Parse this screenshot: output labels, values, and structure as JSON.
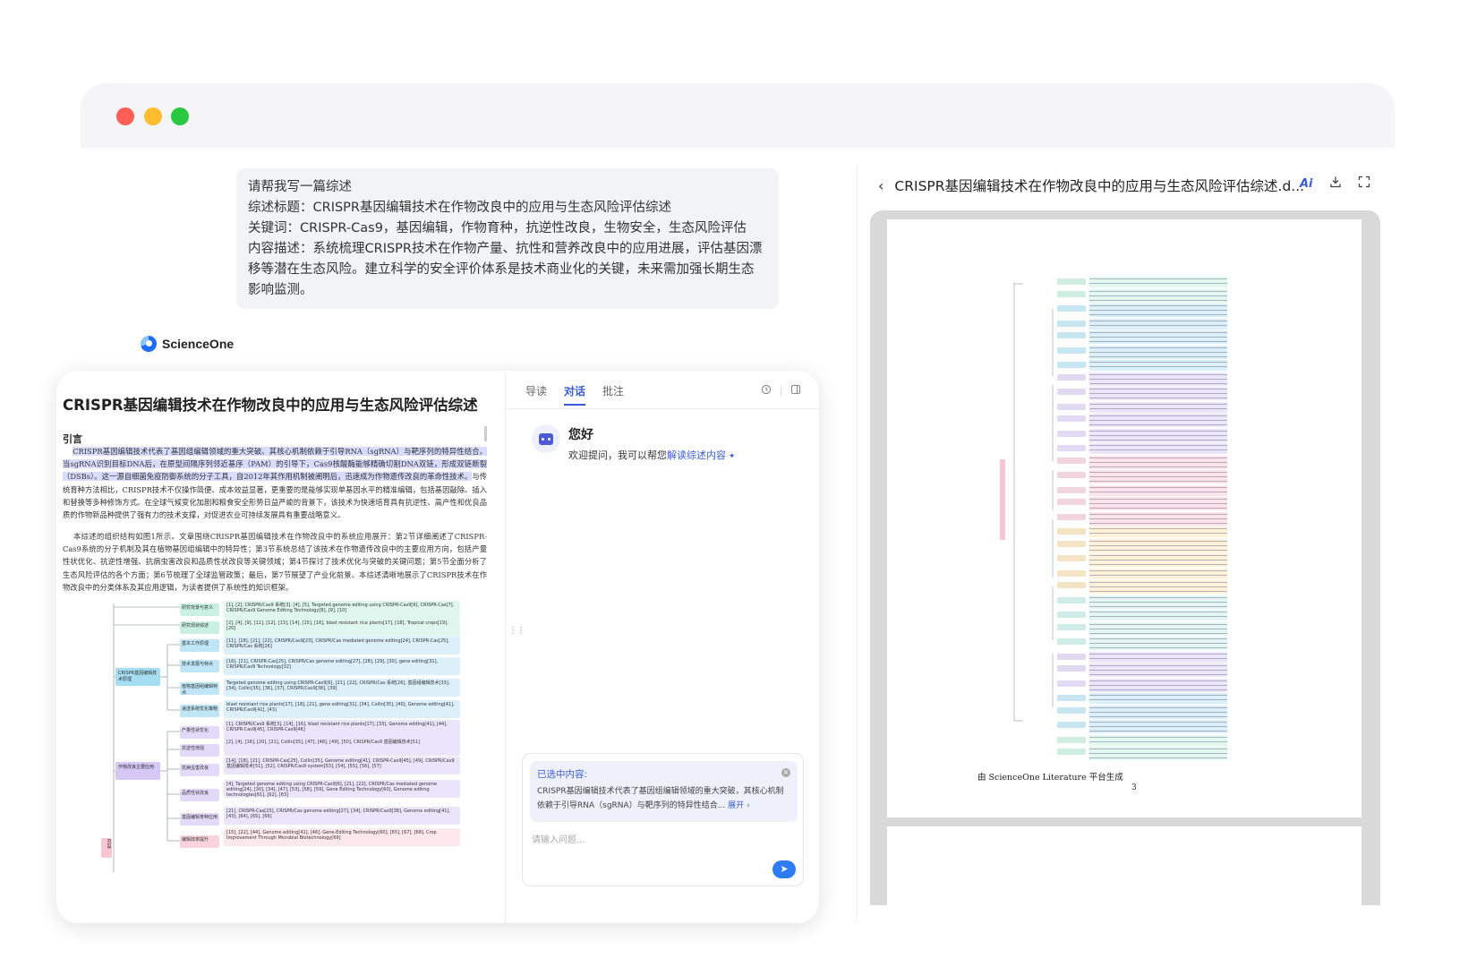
{
  "window": {
    "dots": [
      "#ff5f57",
      "#febc2e",
      "#28c840"
    ]
  },
  "prompt": {
    "lines": [
      "请帮我写一篇综述",
      "综述标题：CRISPR基因编辑技术在作物改良中的应用与生态风险评估综述",
      "关键词：CRISPR-Cas9，基因编辑，作物育种，抗逆性改良，生物安全，生态风险评估",
      "内容描述：系统梳理CRISPR技术在作物产量、抗性和营养改良中的应用进展，评估基因漂移等潜在生态风险。建立科学的安全评价体系是技术商业化的关键，未来需加强长期生态影响监测。"
    ]
  },
  "brand": {
    "name": "ScienceOne"
  },
  "doc": {
    "title": "CRISPR基因编辑技术在作物改良中的应用与生态风险评估综述",
    "section": "引言",
    "para1_hl": "CRISPR基因编辑技术代表了基因组编辑领域的重大突破。其核心机制依赖于引导RNA（sgRNA）与靶序列的特异性结合。当sgRNA识别目标DNA后，在原型间隔序列邻近基序（PAM）的引导下，Cas9核酸酶能够精确切割DNA双链，形成双链断裂（DSBs）。这一源自细菌免疫防御系统的分子工具，自2012年其作用机制被阐明后，迅速成为作物遗传改良的革命性技术。",
    "para1_rest": "与传统育种方法相比，CRISPR技术不仅操作简便、成本效益显著，更重要的是能够实现单基因水平的精准编辑，包括基因敲除、插入和替换等多种修饰方式。在全球气候变化加剧和粮食安全形势日益严峻的背景下，该技术为快速培育具有抗逆性、高产性和优良品质的作物新品种提供了强有力的技术支撑，对促进农业可持续发展具有重要战略意义。",
    "para2": "本综述的组织结构如图1所示。文章围绕CRISPR基因编辑技术在作物改良中的系统应用展开：第2节详细阐述了CRISPR-Cas9系统的分子机制及其在植物基因组编辑中的特异性；第3节系统总结了该技术在作物遗传改良中的主要应用方向，包括产量性状优化、抗逆性增强、抗病虫害改良和品质性状改良等关键领域；第4节探讨了技术优化与突破的关键问题；第5节全面分析了生态风险评估的各个方面；第6节梳理了全球监管政策；最后，第7节展望了产业化前景。本综述清晰地展示了CRISPR技术在作物改良中的分类体系及其应用逻辑，为读者提供了系统性的知识框架。",
    "mindmap": {
      "l1": [
        {
          "label": "CRISPR基因编辑技术原理",
          "color": "#a5ddf2"
        },
        {
          "label": "作物改良主要应用",
          "color": "#d5c8f7"
        },
        {
          "label": "RGB",
          "color": "#f7c6d2"
        }
      ],
      "l2": [
        {
          "label": "研究背景与意义",
          "color": "#c9f0e3"
        },
        {
          "label": "研究现状综述",
          "color": "#c9f0e3"
        },
        {
          "label": "基本工作原理",
          "color": "#bfe6f7"
        },
        {
          "label": "技术发展与特点",
          "color": "#bfe6f7"
        },
        {
          "label": "植物基因组编辑特点",
          "color": "#bfe6f7"
        },
        {
          "label": "递送系统优化策略",
          "color": "#bfe6f7"
        },
        {
          "label": "产量性状优化",
          "color": "#e2daf9"
        },
        {
          "label": "抗逆性增强",
          "color": "#e2daf9"
        },
        {
          "label": "抗病虫害改良",
          "color": "#e2daf9"
        },
        {
          "label": "品质性状改良",
          "color": "#e2daf9"
        },
        {
          "label": "基因编辑育种应用",
          "color": "#e2daf9"
        },
        {
          "label": "编辑效率提升",
          "color": "#fad4dd"
        }
      ],
      "rows": [
        {
          "text": "[1], [2], CRISPR/Cas9 系统[3], [4], [5], Targeted genome editing using CRISPR-Cas9[6], CRISPR-Cas[7], CRISPR/Cas9 Genome Editing Technology[8], [9], [10]",
          "color": "#dff7ee"
        },
        {
          "text": "[2], [4], [9], [11], [12], [13], [14], [15], [16], blast resistant rice plants[17], [18], Tropical crops[19], [20]",
          "color": "#dff7ee"
        },
        {
          "text": "[11], [18], [21], [22], CRISPR/Cas9[23], CRISPR/Cas mediated genome editing[24], CRISPR-Cas[25], CRISPR/Cas 系统[26]",
          "color": "#dcf0fa"
        },
        {
          "text": "[16], [21], CRISPR-Cas[25], CRISPR/Cas genome editing[27], [28], [29], [30], gene editing[31], CRISPR/Cas9 Technology[32]",
          "color": "#dcf0fa"
        },
        {
          "text": "Targeted genome editing using CRISPR-Cas9[6], [21], [22], CRISPR/Cas 系统[26], 基因组编辑技术[33], [34], Collin[35], [36], [37], CRISPR/Cas9[38], [39]",
          "color": "#dcf0fa"
        },
        {
          "text": "blast resistant rice plants[17], [18], [21], gene editing[31], [34], Collin[35], [40], Genome editing[41], CRISPR/Cas9[42], [43]",
          "color": "#dcf0fa"
        },
        {
          "text": "[1], CRISPR/Cas9 系统[3], [14], [16], blast resistant rice plants[17], [33], Genome editing[41], [44], CRISPR-Cas9[45], CRISPR-Cas9[46]",
          "color": "#ebe5fb"
        },
        {
          "text": "[2], [4], [16], [20], [21], Collin[35], [47], [48], [49], [50], CRISPR/Cas9 基因编辑技术[51]",
          "color": "#ebe5fb"
        },
        {
          "text": "[14], [18], [21], CRISPR-Cas[25], Collin[35], Genome editing[41], CRISPR-Cas9[45], [49], CRISPR/Cas9 基因编辑技术[51], [52], CRISPR/Cas9 system[53], [54], [55], [56], [57]",
          "color": "#ebe5fb"
        },
        {
          "text": "[4], Targeted genome editing using CRISPR-Cas9[6], [21], [22], CRISPR/Cas mediated genome editing[24], [30], [34], [47], [53], [58], [59], Gene Editing Technology[60], Genome editing technologies[61], [62], [63]",
          "color": "#ebe5fb"
        },
        {
          "text": "[21], CRISPR-Cas[25], CRISPR/Cas genome editing[27], [34], CRISPR/Cas9[38], Genome editing[41], [43], [64], [65], [66]",
          "color": "#ebe5fb"
        },
        {
          "text": "[15], [22], [44], Genome editing[41], [46], Gene-Editing Technology[60], [65], [67], [68], Crop Improvement Through Microbial Biotechnology[69]",
          "color": "#fde8ed"
        }
      ]
    }
  },
  "chat": {
    "tabs": [
      "导读",
      "对话",
      "批注"
    ],
    "active_tab": "对话",
    "hello": "您好",
    "welcome_prefix": "欢迎提问，我可以帮您",
    "welcome_link": "解读综述内容",
    "selected_title": "已选中内容:",
    "selected_text": "CRISPR基因编辑技术代表了基因组编辑领域的重大突破，其核心机制依赖于引导RNA（sgRNA）与靶序列的特异性结合...",
    "expand": "展开",
    "placeholder": "请输入问题..."
  },
  "viewer": {
    "title": "CRISPR基因编辑技术在作物改良中的应用与生态风险评估综述.d...",
    "ai_label": "Ai",
    "credit": "由 ScienceOne Literature 平台生成",
    "page_number": "3",
    "row_colors": [
      "#e3f8f0",
      "#e3f8f0",
      "#dcf0fa",
      "#dcf0fa",
      "#dcf0fa",
      "#dcf0fa",
      "#dcf0fa",
      "#ece6fb",
      "#ece6fb",
      "#ece6fb",
      "#ece6fb",
      "#ece6fb",
      "#ece6fb",
      "#fde4ea",
      "#fde4ea",
      "#fde4ea",
      "#fde4ea",
      "#fde4ea",
      "#fef1dc",
      "#fef1dc",
      "#fef1dc",
      "#fef1dc",
      "#fef1dc",
      "#e3f6f4",
      "#e3f6f4",
      "#e3f6f4",
      "#e3f6f4",
      "#ece6fb",
      "#ece6fb",
      "#ece6fb",
      "#dcf0fa",
      "#dcf0fa",
      "#dcf0fa",
      "#e3f8f0",
      "#e3f8f0"
    ]
  }
}
